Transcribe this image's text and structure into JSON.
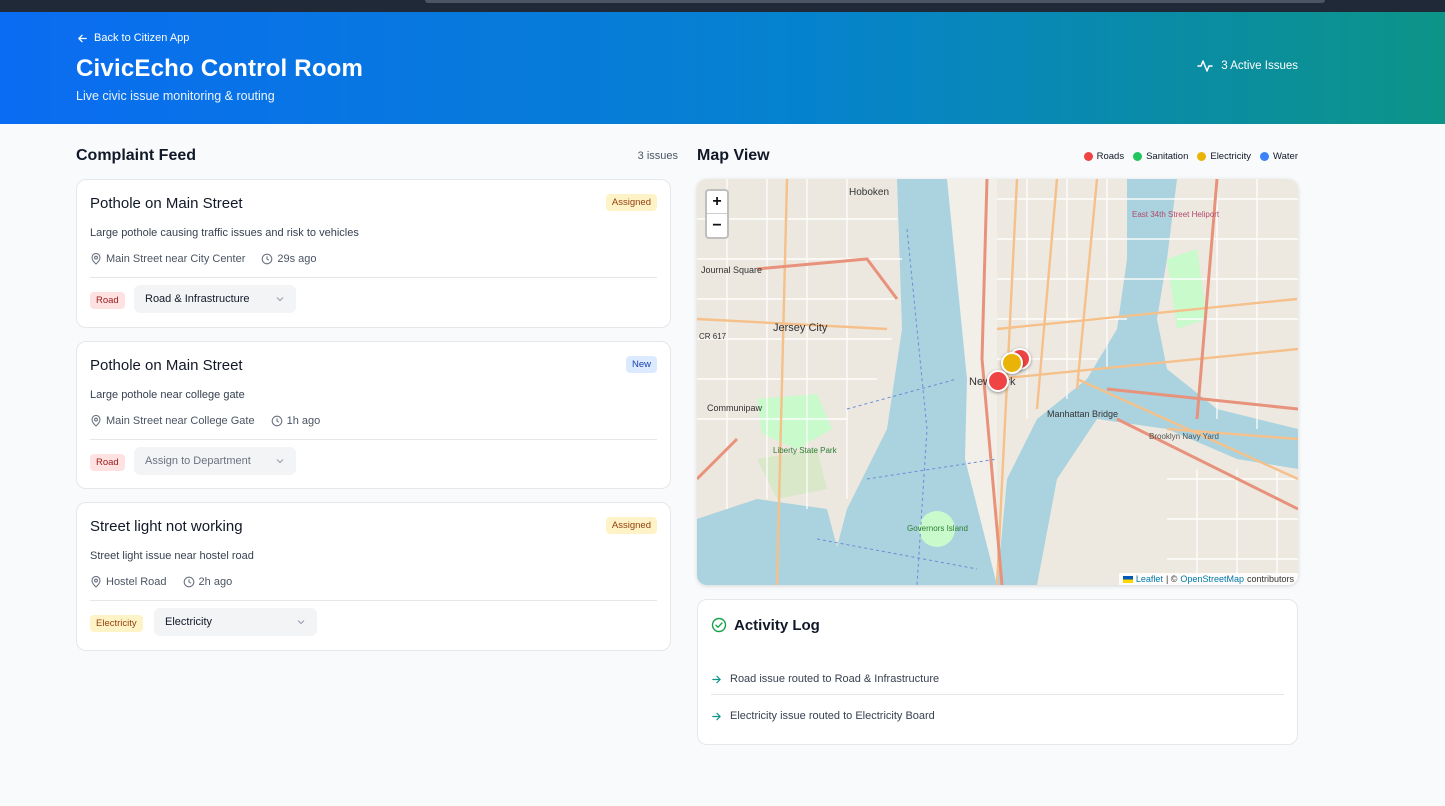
{
  "header": {
    "back_label": "Back to Citizen App",
    "title": "CivicEcho Control Room",
    "subtitle": "Live civic issue monitoring & routing",
    "active_issues": "3 Active Issues"
  },
  "feed": {
    "title": "Complaint Feed",
    "count": "3 issues",
    "items": [
      {
        "title": "Pothole on Main Street",
        "status": "Assigned",
        "description": "Large pothole causing traffic issues and risk to vehicles",
        "location": "Main Street near City Center",
        "time": "29s ago",
        "category": "Road",
        "department": "Road & Infrastructure"
      },
      {
        "title": "Pothole on Main Street",
        "status": "New",
        "description": "Large pothole near college gate",
        "location": "Main Street near College Gate",
        "time": "1h ago",
        "category": "Road",
        "department": "Assign to Department"
      },
      {
        "title": "Street light not working",
        "status": "Assigned",
        "description": "Street light issue near hostel road",
        "location": "Hostel Road",
        "time": "2h ago",
        "category": "Electricity",
        "department": "Electricity"
      }
    ]
  },
  "map": {
    "title": "Map View",
    "legend": [
      {
        "label": "Roads",
        "color": "#ef4444"
      },
      {
        "label": "Sanitation",
        "color": "#22c55e"
      },
      {
        "label": "Electricity",
        "color": "#eab308"
      },
      {
        "label": "Water",
        "color": "#3b82f6"
      }
    ],
    "zoom_in": "+",
    "zoom_out": "−",
    "attribution": {
      "leaflet": "Leaflet",
      "sep": "| ©",
      "osm": "OpenStreetMap",
      "suffix": "contributors"
    },
    "labels": {
      "hoboken": "Hoboken",
      "journal_square": "Journal Square",
      "jersey_city": "Jersey City",
      "communipaw": "Communipaw",
      "liberty": "Liberty State Park",
      "new_york": "New York",
      "manhattan_bridge": "Manhattan Bridge",
      "governors": "Governors Island",
      "brooklyn_navy": "Brooklyn Navy Yard",
      "east_34": "East 34th Street Heliport",
      "cr617": "CR 617"
    }
  },
  "activity": {
    "title": "Activity Log",
    "entries": [
      "Road issue routed to Road & Infrastructure",
      "Electricity issue routed to Electricity Board"
    ]
  }
}
